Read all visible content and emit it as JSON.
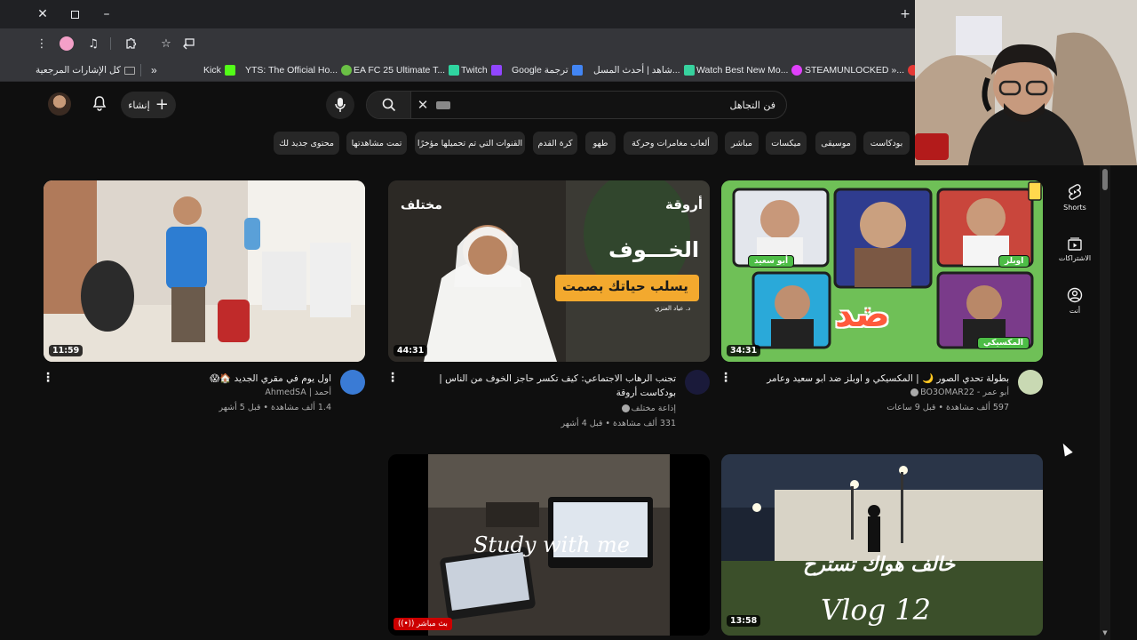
{
  "browser": {
    "bookmarks": [
      {
        "label": "كل الإشارات المرجعية",
        "icon": "folder-icon",
        "color": "#aaaaaa"
      },
      {
        "label": "Kick",
        "icon": "kick-favicon",
        "color": "#53fc18"
      },
      {
        "label": "YTS: The Official Ho...",
        "icon": "yts-favicon",
        "color": "#6ac045"
      },
      {
        "label": "EA FC 25 Ultimate T...",
        "icon": "futbin-favicon",
        "color": "#2fd5a0"
      },
      {
        "label": "Twitch",
        "icon": "twitch-favicon",
        "color": "#9146ff"
      },
      {
        "label": "Google ترجمة",
        "icon": "google-translate-favicon",
        "color": "#4285f4"
      },
      {
        "label": "شاهد | أحدث المسل...",
        "icon": "shahid-favicon",
        "color": "#37d29e"
      },
      {
        "label": "Watch Best New Mo...",
        "icon": "movie-site-favicon",
        "color": "#e040fb"
      },
      {
        "label": "STEAMUNLOCKED »...",
        "icon": "steamunlocked-favicon",
        "color": "#e53935"
      }
    ]
  },
  "header": {
    "create_label": "إنشاء",
    "search": {
      "value": "فن التجاهل",
      "placeholder": "بحث"
    }
  },
  "chips": [
    "بودكاست",
    "موسيقى",
    "ميكسات",
    "مباشر",
    "ألعاب مغامرات وحركة",
    "طهو",
    "كرة القدم",
    "القنوات التي تم تحميلها مؤخرًا",
    "تمت مشاهدتها",
    "محتوى جديد لك"
  ],
  "guide": {
    "items": [
      {
        "label": "Shorts",
        "icon": "shorts-icon"
      },
      {
        "label": "الاشتراكات",
        "icon": "subscriptions-icon"
      },
      {
        "label": "أنت",
        "icon": "you-icon"
      }
    ]
  },
  "videos": [
    {
      "duration": "34:31",
      "title": "بطولة تحدي الصور 🌙 | المكسيكي و اوبلز ضد ابو سعيد وعامر",
      "channel": "أبو عمر - BO3OMAR22",
      "stats": "597 ألف مشاهدة • قبل 9 ساعات",
      "thumb_text": {
        "main": "ضد",
        "tags": [
          "أبو سعيد",
          "اوبلز",
          "المكسيكي"
        ]
      },
      "channel_color": "#c9d9b3"
    },
    {
      "duration": "44:31",
      "title": "تجنب الرهاب الاجتماعي: كيف تكسر حاجز الخوف من الناس | بودكاست أروقة",
      "channel": "إذاعة مختلف",
      "stats": "331 ألف مشاهدة • قبل 4 أشهر",
      "thumb_text": {
        "logo": "مختلف",
        "brand": "أروقة",
        "headline": "الخـــوف",
        "banner": "يسلب حياتك بصمت",
        "credit": "د. عياد العنزي"
      },
      "channel_color": "#1a1a3a"
    },
    {
      "duration": "11:59",
      "title": "اول يوم في مقري الجديد 🏠😱",
      "channel": "أحمد | AhmedSA",
      "stats": "1.4 ألف مشاهدة • قبل 5 أشهر",
      "channel_color": "#3a7bd5"
    },
    {
      "duration": "13:58",
      "thumb_text": {
        "headline": "خالف هواك تسترح",
        "script": "Vlog 12"
      }
    },
    {
      "live_label": "بث مباشر",
      "thumb_text": {
        "script": "Study with me"
      }
    }
  ]
}
